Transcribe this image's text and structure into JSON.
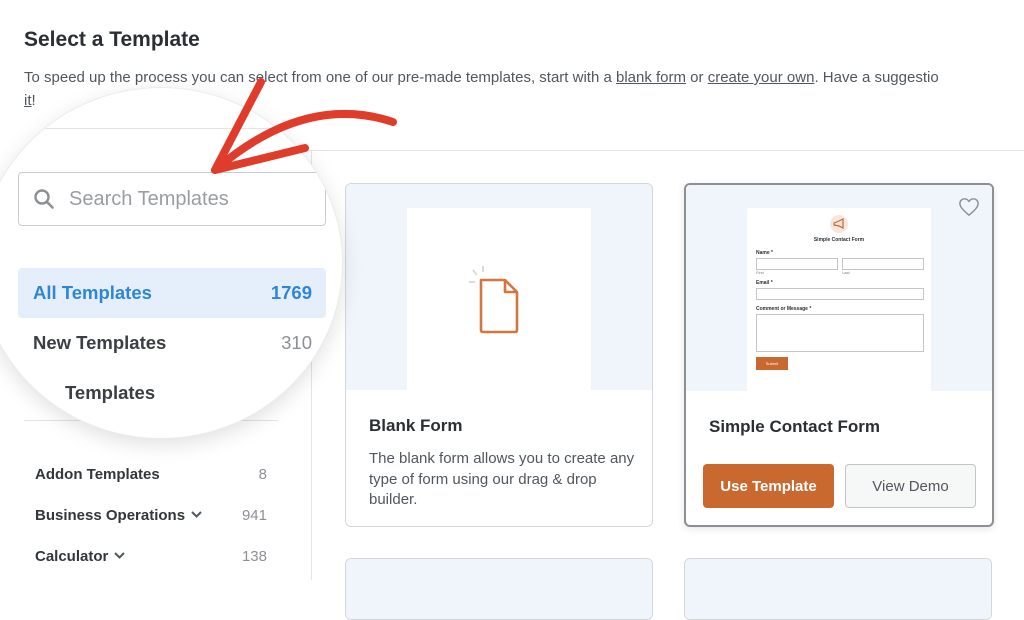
{
  "header": {
    "title": "Select a Template",
    "intro_prefix": "To speed up the process you can select from one of our pre-made templates, start with a ",
    "intro_link_blank": "blank form",
    "intro_middle": " or ",
    "intro_link_create": "create your own",
    "intro_suffix": ". Have a suggestio",
    "intro_line2_link": "it",
    "intro_line2_suffix": "!"
  },
  "search": {
    "placeholder": "Search Templates",
    "value": ""
  },
  "magnified_categories": [
    {
      "label": "All Templates",
      "count": "1769",
      "active": true
    },
    {
      "label": "New Templates",
      "count": "310",
      "active": false
    },
    {
      "label": "Templates",
      "count": "",
      "active": false
    }
  ],
  "sidebar": {
    "items": [
      {
        "label": "Addon Templates",
        "count": "8",
        "chevron": false
      },
      {
        "label": "Business Operations",
        "count": "941",
        "chevron": true
      },
      {
        "label": "Calculator",
        "count": "138",
        "chevron": true
      }
    ]
  },
  "cards": [
    {
      "title": "Blank Form",
      "description": "The blank form allows you to create any type of form using our drag & drop builder.",
      "icon": "blank-document-icon"
    },
    {
      "title": "Simple Contact Form",
      "use_button": "Use Template",
      "demo_button": "View Demo",
      "favorite_icon": "heart-icon",
      "preview": {
        "title": "Simple Contact Form",
        "name_label": "Name *",
        "first_label": "First",
        "last_label": "Last",
        "email_label": "Email *",
        "message_label": "Comment or Message *",
        "submit_label": "Submit"
      }
    }
  ],
  "colors": {
    "accent": "#c9682f",
    "active_blue": "#2f86d8",
    "active_bg": "#e5effb",
    "arrow_red": "#e03c2c",
    "preview_bg": "#f0f5fb"
  }
}
